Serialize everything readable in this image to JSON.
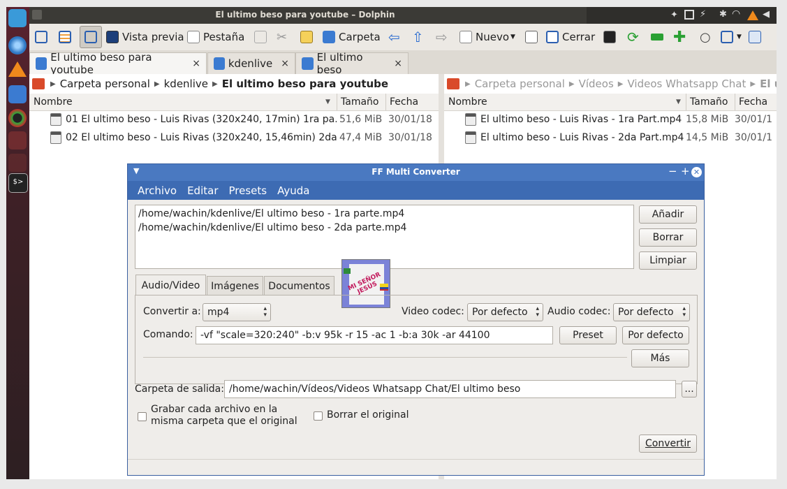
{
  "window": {
    "title": "El ultimo beso para youtube – Dolphin"
  },
  "toolbar": {
    "preview": "Vista previa",
    "tab": "Pestaña",
    "folder": "Carpeta",
    "new": "Nuevo",
    "close": "Cerrar"
  },
  "tabs": [
    {
      "label": "El ultimo beso para youtube",
      "close": "×"
    },
    {
      "label": "kdenlive",
      "close": "×"
    },
    {
      "label": "El ultimo beso",
      "close": "×"
    }
  ],
  "left_pane": {
    "breadcrumb": [
      "Carpeta personal",
      "kdenlive",
      "El ultimo beso para youtube"
    ],
    "columns": {
      "name": "Nombre",
      "size": "Tamaño",
      "date": "Fecha"
    },
    "files": [
      {
        "name": "01 El ultimo beso - Luis Rivas (320x240, 17min) 1ra pa...",
        "size": "51,6 MiB",
        "date": "30/01/18"
      },
      {
        "name": "02 El ultimo beso - Luis Rivas (320x240, 15,46min) 2da...",
        "size": "47,4 MiB",
        "date": "30/01/18"
      }
    ]
  },
  "right_pane": {
    "breadcrumb": [
      "Carpeta personal",
      "Vídeos",
      "Videos Whatsapp Chat",
      "El ultim"
    ],
    "columns": {
      "name": "Nombre",
      "size": "Tamaño",
      "date": "Fecha"
    },
    "files": [
      {
        "name": "El ultimo beso - Luis Rivas - 1ra Part.mp4",
        "size": "15,8 MiB",
        "date": "30/01/1"
      },
      {
        "name": "El ultimo beso - Luis Rivas - 2da Part.mp4",
        "size": "14,5 MiB",
        "date": "30/01/1"
      }
    ]
  },
  "dialog": {
    "title": "FF Multi Converter",
    "menu": [
      "Archivo",
      "Editar",
      "Presets",
      "Ayuda"
    ],
    "files": [
      "/home/wachin/kdenlive/El ultimo beso - 1ra parte.mp4",
      "/home/wachin/kdenlive/El ultimo beso - 2da parte.mp4"
    ],
    "buttons": {
      "add": "Añadir",
      "delete": "Borrar",
      "clear": "Limpiar",
      "preset": "Preset",
      "default": "Por defecto",
      "more": "Más",
      "browse": "...",
      "convert": "Convertir"
    },
    "tabs": [
      "Audio/Video",
      "Imágenes",
      "Documentos"
    ],
    "logo_text": "MI SEÑOR JESÚS",
    "convert_to_label": "Convertir a:",
    "convert_to_value": "mp4",
    "video_codec_label": "Video codec:",
    "video_codec_value": "Por defecto",
    "audio_codec_label": "Audio codec:",
    "audio_codec_value": "Por defecto",
    "command_label": "Comando:",
    "command_value": "-vf \"scale=320:240\" -b:v 95k -r 15 -ac 1 -b:a 30k -ar 44100",
    "output_label": "Carpeta de salida:",
    "output_value": "/home/wachin/Vídeos/Videos Whatsapp Chat/El ultimo beso",
    "save_same_folder": "Grabar cada archivo en la misma carpeta que el original",
    "delete_original": "Borrar el original"
  },
  "colors": {
    "dialog_title": "#4a79c1",
    "dialog_menu": "#3d6bb3",
    "titlebar": "#3b3a36"
  }
}
